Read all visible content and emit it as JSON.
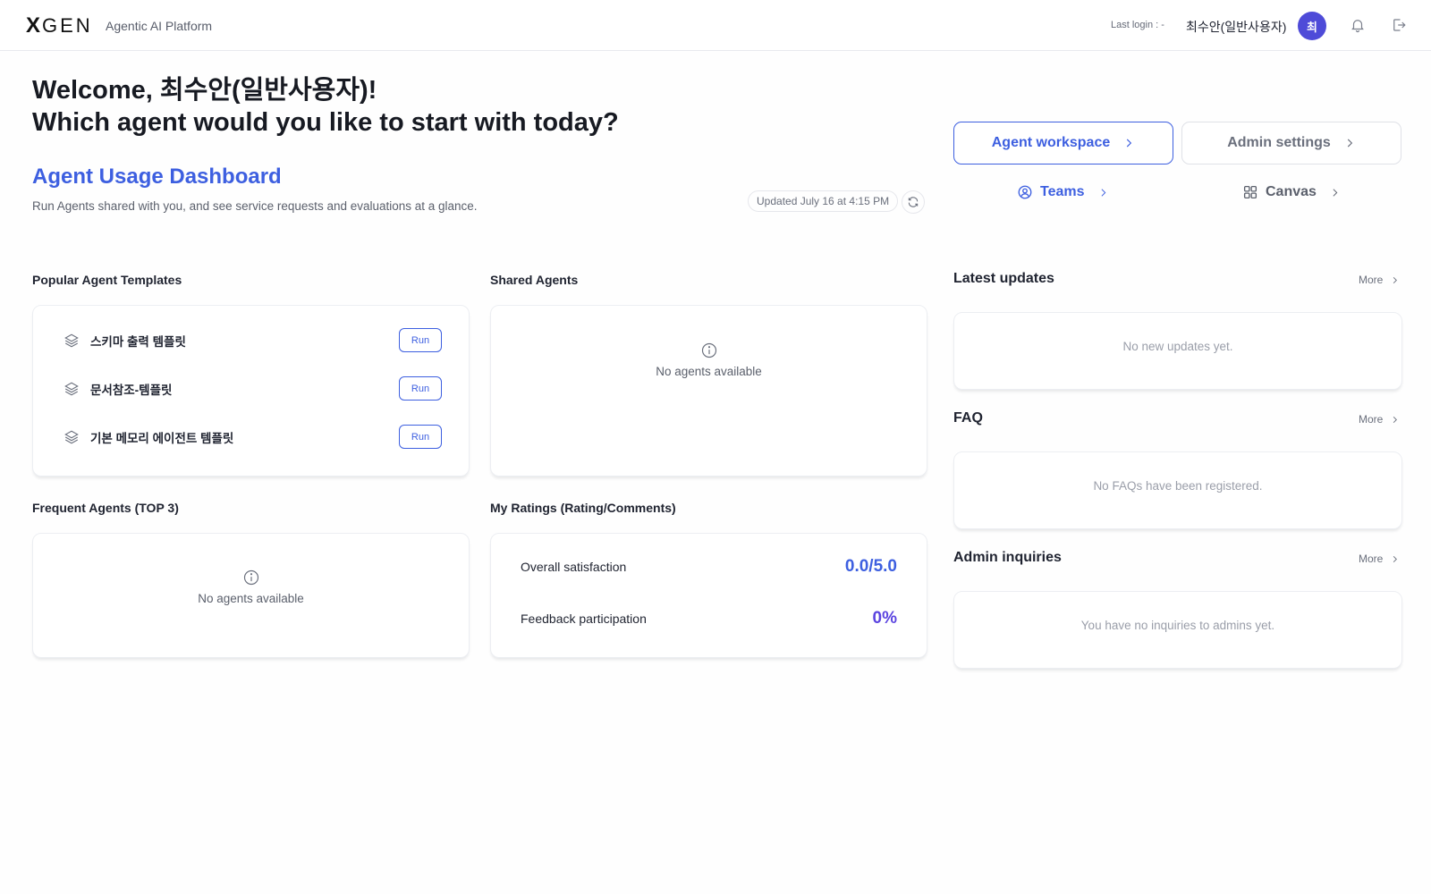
{
  "header": {
    "logo_mark": "X",
    "logo_text": "GEN",
    "subtitle": "Agentic AI Platform",
    "last_login": "Last login : -",
    "username": "최수안(일반사용자)",
    "avatar_initial": "최",
    "icons": [
      "bell-icon",
      "logout-icon"
    ]
  },
  "welcome": {
    "line1": "Welcome, 최수안(일반사용자)!",
    "line2": "Which agent would you like to start with today?"
  },
  "dashboard": {
    "title": "Agent Usage Dashboard",
    "description": "Run Agents shared with you, and see service requests and evaluations at a glance.",
    "updated": "Updated July 16 at 4:15 PM"
  },
  "actions": {
    "agent_workspace": "Agent workspace",
    "admin_settings": "Admin settings",
    "teams": "Teams",
    "canvas": "Canvas"
  },
  "popular_templates": {
    "title": "Popular Agent Templates",
    "items": [
      {
        "name": "스키마 출력 템플릿",
        "action": "Run"
      },
      {
        "name": "문서참조-템플릿",
        "action": "Run"
      },
      {
        "name": "기본 메모리 에이전트 템플릿",
        "action": "Run"
      }
    ]
  },
  "shared_agents": {
    "title": "Shared Agents",
    "empty": "No agents available"
  },
  "frequent_agents": {
    "title": "Frequent Agents (TOP 3)",
    "empty": "No agents available"
  },
  "my_ratings": {
    "title": "My Ratings (Rating/Comments)",
    "overall_label": "Overall satisfaction",
    "overall_value": "0.0/5.0",
    "feedback_label": "Feedback participation",
    "feedback_value": "0%"
  },
  "latest_updates": {
    "title": "Latest updates",
    "more": "More",
    "empty": "No new updates yet."
  },
  "faq": {
    "title": "FAQ",
    "more": "More",
    "empty": "No FAQs have been registered."
  },
  "admin_inquiries": {
    "title": "Admin inquiries",
    "more": "More",
    "empty": "You have no inquiries to admins yet."
  },
  "colors": {
    "accent": "#3d5fe0",
    "avatar": "#4e4bd8",
    "feedback": "#5b44e0"
  }
}
